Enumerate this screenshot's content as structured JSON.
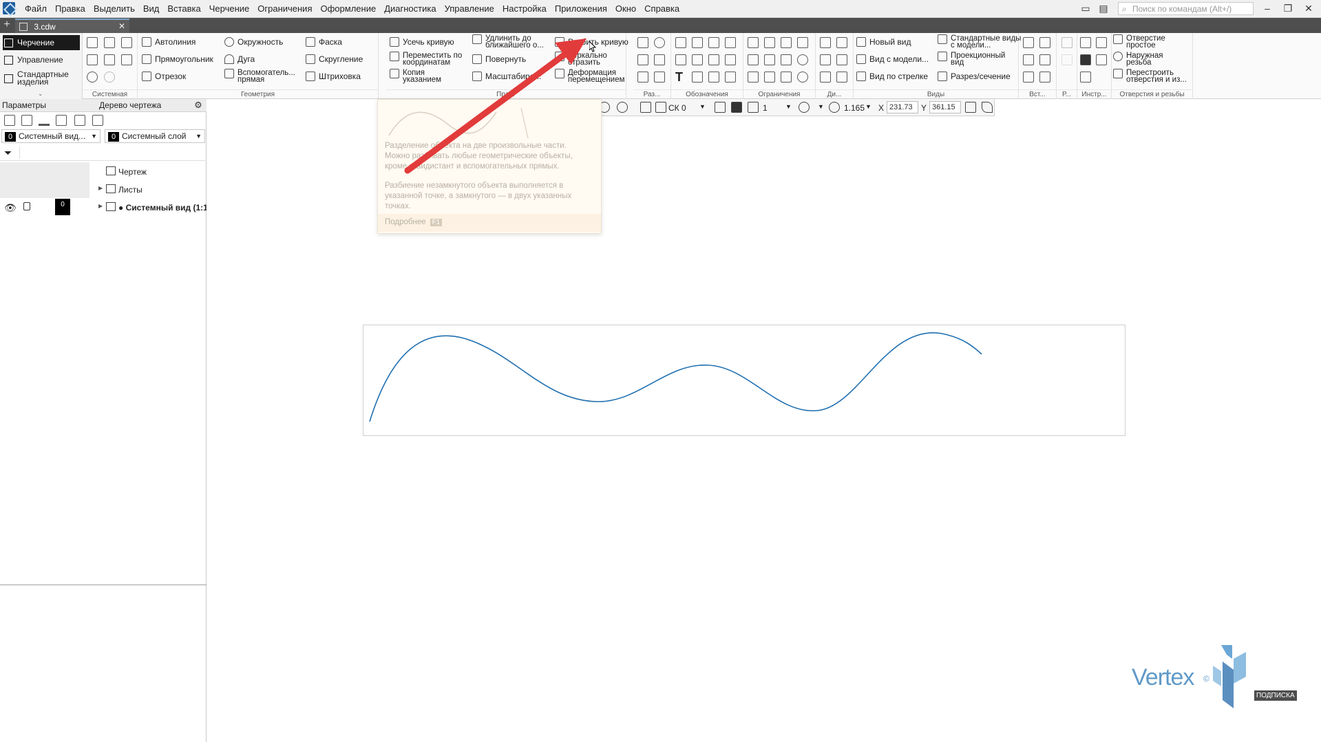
{
  "menu": [
    "Файл",
    "Правка",
    "Выделить",
    "Вид",
    "Вставка",
    "Черчение",
    "Ограничения",
    "Оформление",
    "Диагностика",
    "Управление",
    "Настройка",
    "Приложения",
    "Окно",
    "Справка"
  ],
  "search": {
    "placeholder": "Поиск по командам (Alt+/)"
  },
  "document_tab": {
    "title": "3.cdw"
  },
  "modes": {
    "drawing": "Черчение",
    "management": "Управление",
    "standard": "Стандартные изделия"
  },
  "ribbon": {
    "groups": {
      "system": "Системная",
      "geometry": "Геометрия",
      "edit": "Пра...",
      "dims": "Раз...",
      "marks": "Обозначения",
      "constraints": "Ограничения",
      "di": "Ди...",
      "views": "Виды",
      "insert": "Вст...",
      "r": "Р...",
      "instr": "Инстр...",
      "holes": "Отверстия и резьбы"
    },
    "geometry": {
      "autoline": "Автолиния",
      "rectangle": "Прямоугольник",
      "segment": "Отрезок",
      "circle": "Окружность",
      "arc": "Дуга",
      "aux_line": "Вспомогатель... прямая",
      "chamfer": "Фаска",
      "fillet": "Скругление",
      "hatch": "Штриховка"
    },
    "edit": {
      "trim": "Усечь кривую",
      "extend": "Удлинить до ближайшего о...",
      "split": "Разбить кривую",
      "move": "Переместить по координатам",
      "rotate": "Повернуть",
      "mirror": "Зеркально отразить",
      "copy": "Копия указанием",
      "scale": "Масштабиро...",
      "deform": "Деформация перемещением"
    },
    "views": {
      "new_view": "Новый вид",
      "view_from_model": "Вид с модели...",
      "arrow_view": "Вид по стрелке",
      "standard_views": "Стандартные виды с модели...",
      "projection_view": "Проекционный вид",
      "section": "Разрез/сечение"
    },
    "holes": {
      "simple_hole": "Отверстие простое",
      "outer_thread": "Наружная резьба",
      "rebuild": "Перестроить отверстия и из..."
    }
  },
  "left_panel": {
    "tabs": {
      "params": "Параметры",
      "tree": "Дерево чертежа"
    },
    "view_select": {
      "num": "0",
      "label": "Системный вид..."
    },
    "layer_select": {
      "num": "0",
      "label": "Системный слой"
    },
    "filter_placeholder": "",
    "tree": [
      {
        "label": "Чертеж"
      },
      {
        "label": "Листы"
      },
      {
        "label": "● Системный вид (1:1",
        "num": "0"
      }
    ]
  },
  "canvas_toolbar": {
    "cs": "СК 0",
    "layer": "1",
    "zoom": "1.165",
    "x_label": "X",
    "x_value": "231.73",
    "y_label": "Y",
    "y_value": "361.15"
  },
  "tooltip": {
    "desc1": "Разделение объекта на две произвольные части. Можно разбивать любые геометрические объекты, кроме эквидистант и вспомогательных прямых.",
    "desc2": "Разбиение незамкнутого объекта выполняется в указанной точке, а замкнутого — в двух указанных точках.",
    "more": "Подробнее",
    "key": "F1"
  },
  "watermark": {
    "brand": "Vertex",
    "badge": "ПОДПИСКА"
  },
  "colors": {
    "curve": "#1f6fb0",
    "arrow": "#e23b3b",
    "brand": "#5f99c8"
  }
}
